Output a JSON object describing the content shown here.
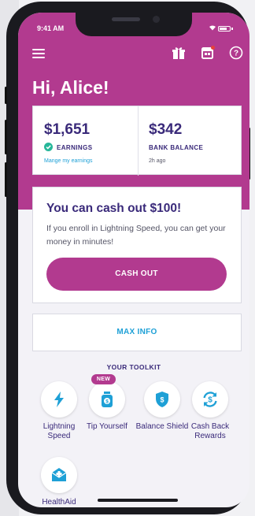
{
  "status_bar": {
    "time": "9:41 AM"
  },
  "header": {
    "greeting": "Hi, Alice!"
  },
  "stats": {
    "earnings": {
      "value": "$1,651",
      "label": "EARNINGS",
      "link": "Mange my earnings"
    },
    "bank": {
      "value": "$342",
      "label": "BANK BALANCE",
      "sub": "2h ago"
    }
  },
  "cashout": {
    "title": "You can cash out $100!",
    "description": "If you enroll in Lightning Speed, you can get your money in minutes!",
    "button": "CASH OUT"
  },
  "max_info": {
    "label": "MAX INFO"
  },
  "toolkit": {
    "title": "YOUR TOOLKIT",
    "items": [
      {
        "label": "Lightning Speed",
        "icon": "lightning-icon"
      },
      {
        "label": "Tip Yourself",
        "icon": "jar-icon",
        "badge": "NEW"
      },
      {
        "label": "Balance Shield",
        "icon": "shield-icon"
      },
      {
        "label": "Cash Back Rewards",
        "icon": "refresh-dollar-icon"
      },
      {
        "label": "HealthAid",
        "icon": "medical-envelope-icon"
      }
    ]
  },
  "colors": {
    "brand": "#b23a8f",
    "navy": "#3a2a7a",
    "link": "#1ea0d6",
    "success": "#27b79a"
  }
}
